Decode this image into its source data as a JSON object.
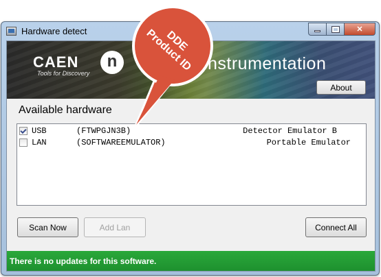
{
  "window": {
    "title": "Hardware detect"
  },
  "banner": {
    "caen_logo": "CAEN",
    "caen_tagline": "Tools for Discovery",
    "n_logo": "n",
    "text": "nstrumentation",
    "about_label": "About"
  },
  "callout": {
    "line1": "DDE",
    "line2": "Product ID",
    "color": "#d9533b"
  },
  "main": {
    "section_title": "Available hardware",
    "hardware": [
      {
        "checked": true,
        "type": "USB",
        "serial": "(FTWPGJN3B)",
        "description": "Detector Emulator B"
      },
      {
        "checked": false,
        "type": "LAN",
        "serial": "(SOFTWAREEMULATOR)",
        "description": "Portable Emulator"
      }
    ],
    "scan_label": "Scan Now",
    "add_lan_label": "Add Lan",
    "connect_label": "Connect All"
  },
  "status": {
    "text": "There is no updates for this software.",
    "color": "#1d8f2e"
  }
}
